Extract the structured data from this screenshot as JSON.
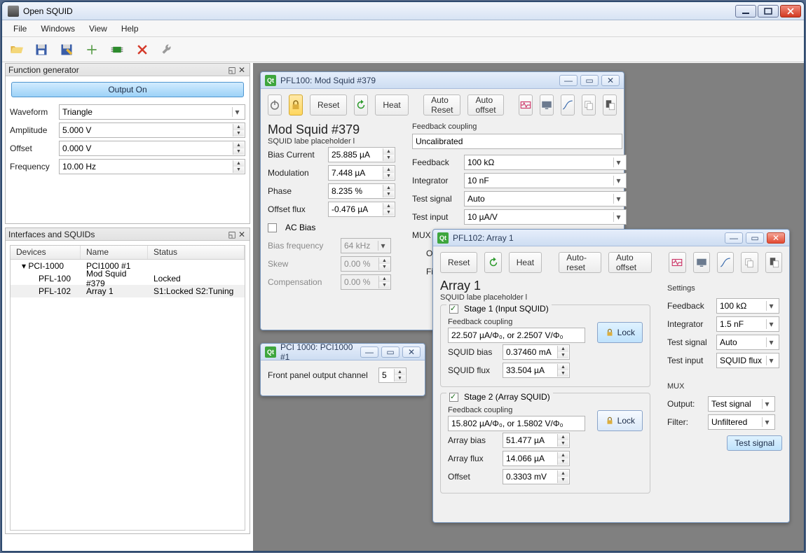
{
  "app": {
    "title": "Open SQUID"
  },
  "menu": {
    "file": "File",
    "windows": "Windows",
    "view": "View",
    "help": "Help"
  },
  "funcgen": {
    "title": "Function generator",
    "output_on": "Output On",
    "waveform_lbl": "Waveform",
    "waveform": "Triangle",
    "amplitude_lbl": "Amplitude",
    "amplitude": "5.000 V",
    "offset_lbl": "Offset",
    "offset": "0.000 V",
    "frequency_lbl": "Frequency",
    "frequency": "10.00 Hz"
  },
  "tree": {
    "title": "Interfaces and SQUIDs",
    "cols": {
      "devices": "Devices",
      "name": "Name",
      "status": "Status"
    },
    "rows": [
      {
        "dev": "PCI-1000",
        "name": "PCI1000 #1",
        "status": ""
      },
      {
        "dev": "PFL-100",
        "name": "Mod Squid #379",
        "status": "Locked"
      },
      {
        "dev": "PFL-102",
        "name": "Array 1",
        "status": "S1:Locked  S2:Tuning"
      }
    ]
  },
  "pfl100": {
    "wintitle": "PFL100: Mod Squid #379",
    "reset": "Reset",
    "heat": "Heat",
    "autoreset": "Auto Reset",
    "autooffset": "Auto offset",
    "h2": "Mod Squid #379",
    "subtitle": "SQUID labe placeholder l",
    "bias_current_lbl": "Bias Current",
    "bias_current": "25.885 µA",
    "modulation_lbl": "Modulation",
    "modulation": "7.448 µA",
    "phase_lbl": "Phase",
    "phase": "8.235 %",
    "offset_flux_lbl": "Offset flux",
    "offset_flux": "-0.476 µA",
    "acbias_lbl": "AC Bias",
    "bias_freq_lbl": "Bias frequency",
    "bias_freq": "64 kHz",
    "skew_lbl": "Skew",
    "skew": "0.00 %",
    "comp_lbl": "Compensation",
    "comp": "0.00 %",
    "fb_coupling_title": "Feedback coupling",
    "fb_coupling": "Uncalibrated",
    "feedback_lbl": "Feedback",
    "feedback": "100 kΩ",
    "integrator_lbl": "Integrator",
    "integrator": "10 nF",
    "testsig_lbl": "Test signal",
    "testsig": "Auto",
    "testin_lbl": "Test input",
    "testin": "10 µA/V",
    "mux_lbl": "MUX",
    "output_lbl": "Output",
    "filter_lbl": "Filter:"
  },
  "pci1000": {
    "wintitle": "PCI 1000: PCI1000 #1",
    "front_lbl": "Front panel output channel",
    "front_val": "5"
  },
  "pfl102": {
    "wintitle": "PFL102: Array 1",
    "reset": "Reset",
    "heat": "Heat",
    "autoreset": "Auto-reset",
    "autooffset": "Auto offset",
    "h2": "Array 1",
    "subtitle": "SQUID labe placeholder l",
    "stage1_title": "Stage 1 (Input SQUID)",
    "fb_coupling_lbl": "Feedback coupling",
    "fb_coupling1": "22.507 µA/Φ₀, or 2.2507 V/Φ₀",
    "lock": "Lock",
    "sqbias_lbl": "SQUID bias",
    "sqbias": "0.37460 mA",
    "sqflux_lbl": "SQUID flux",
    "sqflux": "33.504 µA",
    "stage2_title": "Stage 2 (Array SQUID)",
    "fb_coupling2": "15.802 µA/Φ₀, or 1.5802 V/Φ₀",
    "arrbias_lbl": "Array bias",
    "arrbias": "51.477 µA",
    "arrflux_lbl": "Array flux",
    "arrflux": "14.066 µA",
    "offset_lbl": "Offset",
    "offset": "0.3303 mV",
    "settings_title": "Settings",
    "feedback": "100 kΩ",
    "integrator": "1.5 nF",
    "testsig": "Auto",
    "testinput_lbl": "Test input",
    "testinput": "SQUID flux",
    "mux_title": "MUX",
    "mux_output_lbl": "Output:",
    "mux_output": "Test signal",
    "mux_filter_lbl": "Filter:",
    "mux_filter": "Unfiltered",
    "testsignal_btn": "Test signal"
  }
}
